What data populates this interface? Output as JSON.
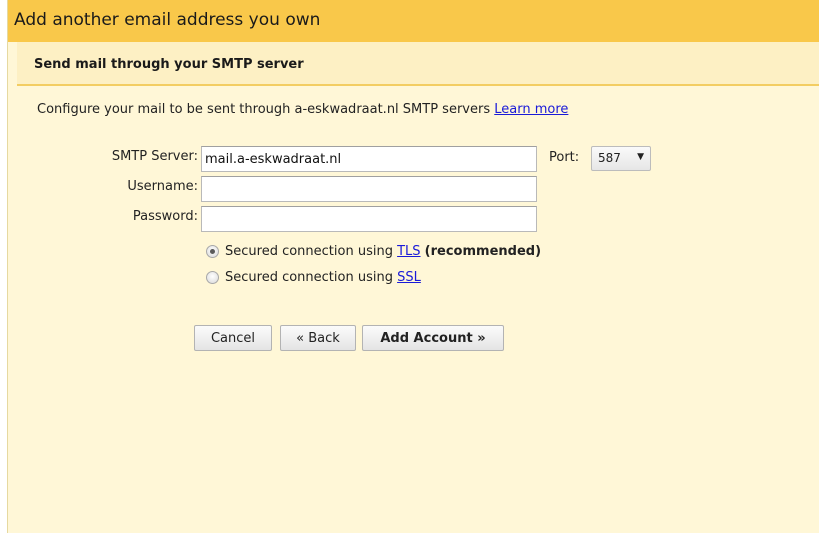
{
  "dialog": {
    "title": "Add another email address you own",
    "subtitle": "Send mail through your SMTP server",
    "description": "Configure your mail to be sent through a-eskwadraat.nl SMTP servers",
    "learn_more": "Learn more"
  },
  "form": {
    "smtp_server": {
      "label": "SMTP Server:",
      "value": "mail.a-eskwadraat.nl"
    },
    "port": {
      "label": "Port:",
      "selected": "587"
    },
    "username": {
      "label": "Username:",
      "value": ""
    },
    "password": {
      "label": "Password:",
      "value": ""
    }
  },
  "security": {
    "tls": {
      "text": "Secured connection using",
      "link": "TLS",
      "suffix": "(recommended)",
      "checked": true
    },
    "ssl": {
      "text": "Secured connection using",
      "link": "SSL",
      "checked": false
    }
  },
  "buttons": {
    "cancel": "Cancel",
    "back": "« Back",
    "add_account": "Add Account »"
  },
  "colors": {
    "title_bar": "#f9c84a",
    "panel_background": "#fff7d7",
    "link": "#1a1ad8"
  }
}
